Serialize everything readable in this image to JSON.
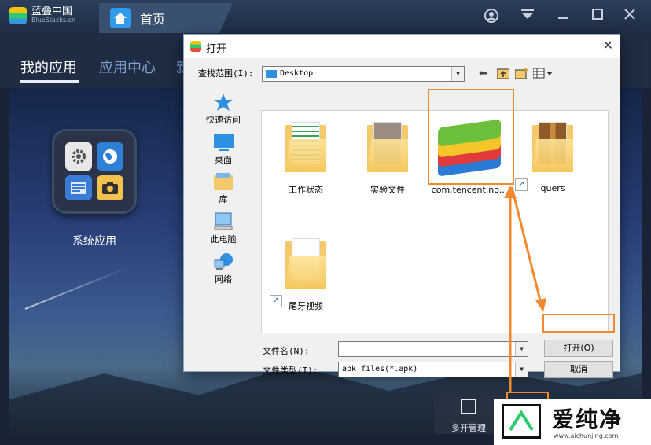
{
  "app": {
    "brand_name": "蓝叠中国",
    "brand_sub": "BlueStacks.cn",
    "home_tab": "首页"
  },
  "window_controls": [
    "account-icon",
    "menu-icon",
    "minimize-icon",
    "maximize-icon",
    "close-icon"
  ],
  "nav": {
    "my_apps": "我的应用",
    "app_center": "应用中心",
    "clipped": "新"
  },
  "main": {
    "system_apps_label": "系统应用",
    "multi_instance_label": "多开管理"
  },
  "dialog": {
    "title": "打开",
    "lookin_label": "查找范围(I):",
    "lookin_value": "Desktop",
    "places": [
      {
        "label": "快速访问",
        "icon": "quick-access-icon"
      },
      {
        "label": "桌面",
        "icon": "desktop-icon"
      },
      {
        "label": "库",
        "icon": "library-icon"
      },
      {
        "label": "此电脑",
        "icon": "this-pc-icon"
      },
      {
        "label": "网络",
        "icon": "network-icon"
      }
    ],
    "files": [
      {
        "label": "工作状态",
        "type": "folder"
      },
      {
        "label": "实验文件",
        "type": "folder"
      },
      {
        "label": "com.tencent.no...",
        "type": "apk"
      },
      {
        "label": "quers",
        "type": "folder-shortcut"
      },
      {
        "label": "尾牙视频",
        "type": "folder-shortcut"
      }
    ],
    "filename_label": "文件名(N):",
    "filename_value": "",
    "filetype_label": "文件类型(T):",
    "filetype_value": "apk files(*.apk)",
    "open_button": "打开(O)",
    "cancel_button": "取消"
  },
  "watermark": {
    "text": "爱纯净",
    "url": "www.aichunjing.com"
  },
  "colors": {
    "highlight": "#f08a2c",
    "titlebar": "#2c3e5a",
    "dialog_bg": "#f0f0f0"
  }
}
